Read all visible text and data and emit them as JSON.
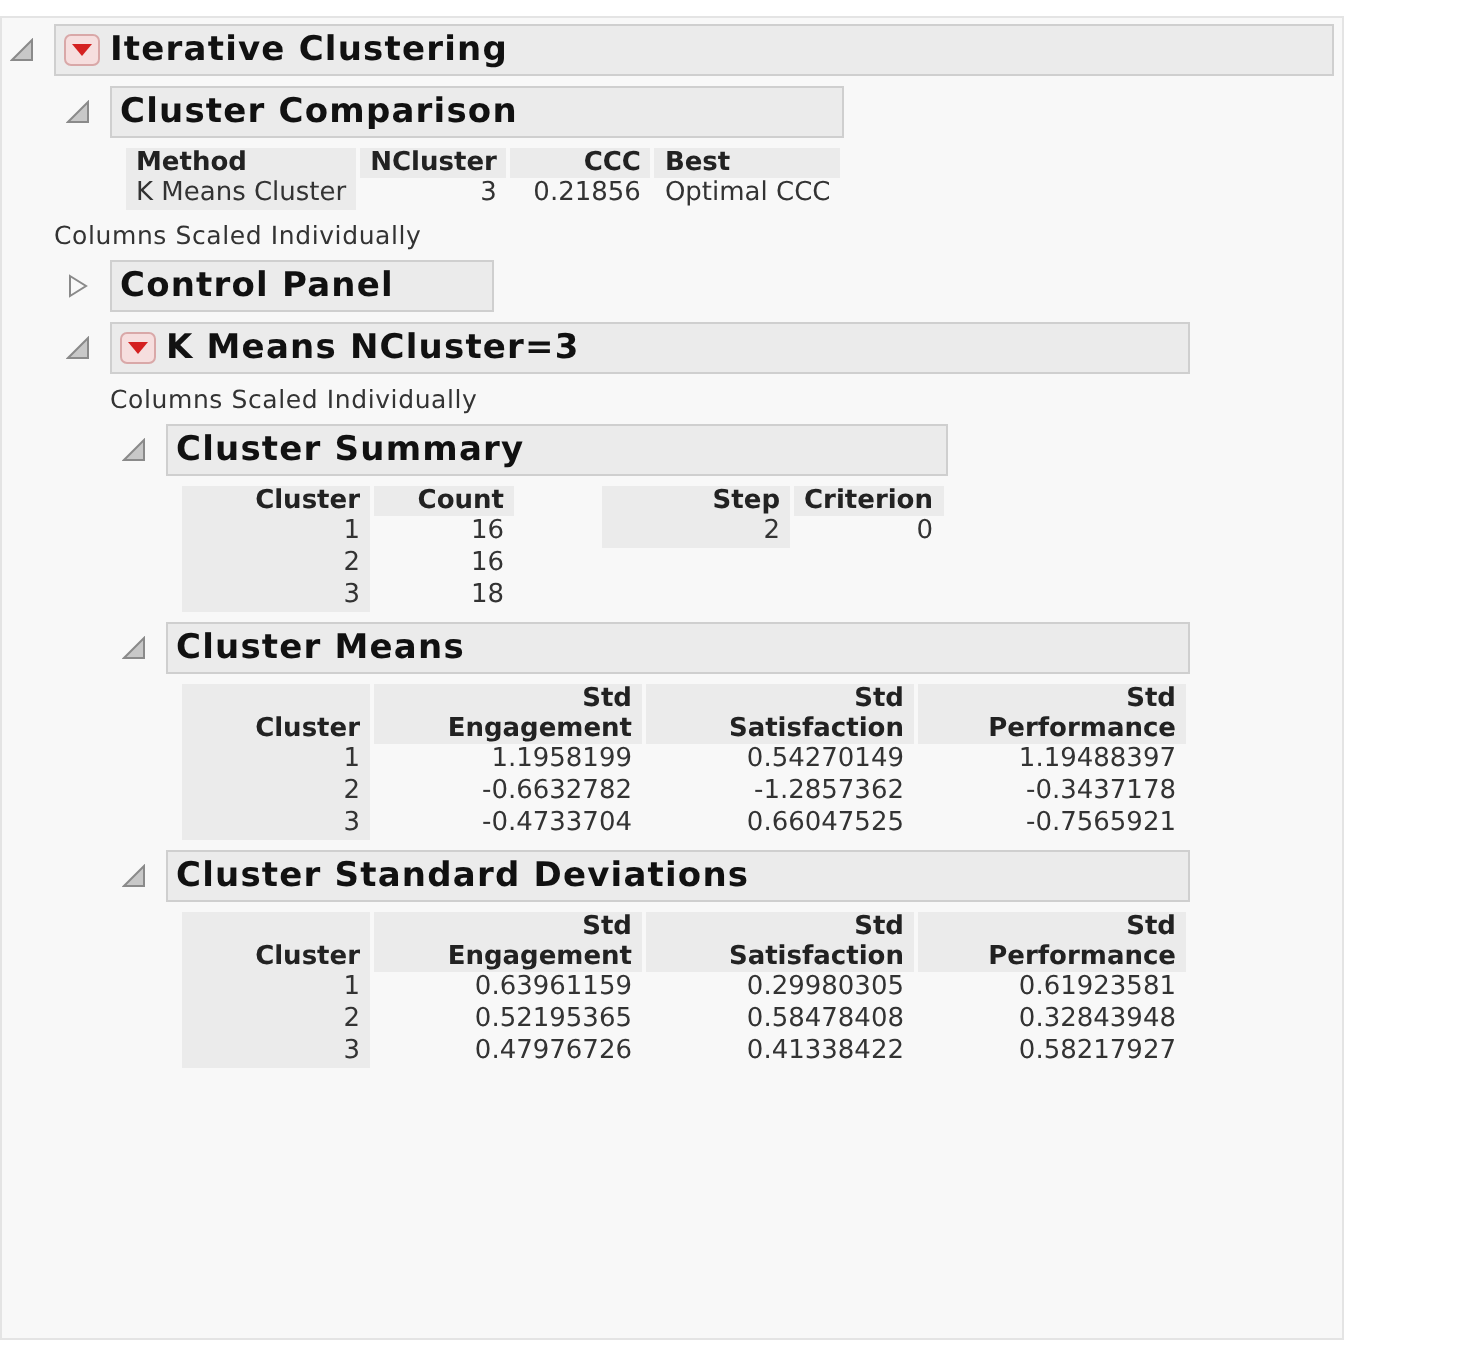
{
  "report": [
    {
      "kind": "outline",
      "title": "Iterative Clustering",
      "expanded": true,
      "menu": true,
      "children": [
        {
          "kind": "outline",
          "title": "Cluster Comparison",
          "expanded": true,
          "menu": false,
          "children": [
            {
              "kind": "tables",
              "tables": [
                {
                  "columns": [
                    {
                      "header": [
                        "Method"
                      ],
                      "kind": "label"
                    },
                    {
                      "header": [
                        "NCluster"
                      ],
                      "kind": "number"
                    },
                    {
                      "header": [
                        "CCC"
                      ],
                      "kind": "number"
                    },
                    {
                      "header": [
                        "Best"
                      ],
                      "kind": "label"
                    }
                  ],
                  "rows": [
                    [
                      "K Means Cluster",
                      "3",
                      "0.21856",
                      "Optimal CCC"
                    ]
                  ]
                }
              ]
            }
          ]
        },
        {
          "kind": "note",
          "text": "Columns Scaled Individually"
        },
        {
          "kind": "outline",
          "title": "Control Panel",
          "expanded": false,
          "menu": false
        },
        {
          "kind": "outline",
          "title": "K Means NCluster=3",
          "expanded": true,
          "menu": true,
          "children": [
            {
              "kind": "note",
              "text": "Columns Scaled Individually"
            },
            {
              "kind": "outline",
              "title": "Cluster Summary",
              "expanded": true,
              "menu": false,
              "children": [
                {
                  "kind": "tables",
                  "tables": [
                    {
                      "columns": [
                        {
                          "header": [
                            "Cluster"
                          ],
                          "kind": "number"
                        },
                        {
                          "header": [
                            "Count"
                          ],
                          "kind": "number"
                        }
                      ],
                      "rows": [
                        [
                          "1",
                          "16"
                        ],
                        [
                          "2",
                          "16"
                        ],
                        [
                          "3",
                          "18"
                        ]
                      ]
                    },
                    {
                      "columns": [
                        {
                          "header": [
                            "Step"
                          ],
                          "kind": "number"
                        },
                        {
                          "header": [
                            "Criterion"
                          ],
                          "kind": "number"
                        }
                      ],
                      "rows": [
                        [
                          "2",
                          "0"
                        ]
                      ]
                    }
                  ]
                }
              ]
            },
            {
              "kind": "outline",
              "title": "Cluster Means",
              "expanded": true,
              "menu": false,
              "children": [
                {
                  "kind": "tables",
                  "tables": [
                    {
                      "columns": [
                        {
                          "header": [
                            "Cluster"
                          ],
                          "kind": "number"
                        },
                        {
                          "header": [
                            "Std",
                            "Engagement"
                          ],
                          "kind": "number"
                        },
                        {
                          "header": [
                            "Std",
                            "Satisfaction"
                          ],
                          "kind": "number"
                        },
                        {
                          "header": [
                            "Std",
                            "Performance"
                          ],
                          "kind": "number"
                        }
                      ],
                      "rows": [
                        [
                          "1",
                          "1.1958199",
                          "0.54270149",
                          "1.19488397"
                        ],
                        [
                          "2",
                          "-0.6632782",
                          "-1.2857362",
                          "-0.3437178"
                        ],
                        [
                          "3",
                          "-0.4733704",
                          "0.66047525",
                          "-0.7565921"
                        ]
                      ]
                    }
                  ]
                }
              ]
            },
            {
              "kind": "outline",
              "title": "Cluster Standard Deviations",
              "expanded": true,
              "menu": false,
              "children": [
                {
                  "kind": "tables",
                  "tables": [
                    {
                      "columns": [
                        {
                          "header": [
                            "Cluster"
                          ],
                          "kind": "number"
                        },
                        {
                          "header": [
                            "Std",
                            "Engagement"
                          ],
                          "kind": "number"
                        },
                        {
                          "header": [
                            "Std",
                            "Satisfaction"
                          ],
                          "kind": "number"
                        },
                        {
                          "header": [
                            "Std",
                            "Performance"
                          ],
                          "kind": "number"
                        }
                      ],
                      "rows": [
                        [
                          "1",
                          "0.63961159",
                          "0.29980305",
                          "0.61923581"
                        ],
                        [
                          "2",
                          "0.52195365",
                          "0.58478408",
                          "0.32843948"
                        ],
                        [
                          "3",
                          "0.47976726",
                          "0.41338422",
                          "0.58217927"
                        ]
                      ]
                    }
                  ]
                }
              ]
            }
          ]
        }
      ]
    }
  ]
}
